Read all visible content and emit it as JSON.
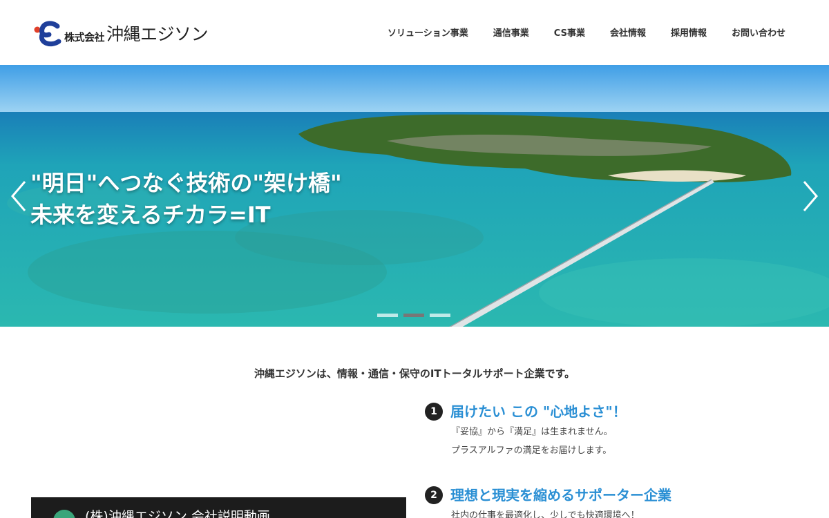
{
  "header": {
    "logo_small": "株式会社",
    "logo_big": "沖縄エジソン",
    "nav": [
      {
        "label": "ソリューション事業"
      },
      {
        "label": "通信事業"
      },
      {
        "label": "CS事業"
      },
      {
        "label": "会社情報"
      },
      {
        "label": "採用情報"
      },
      {
        "label": "お問い合わせ"
      }
    ]
  },
  "hero": {
    "line1": "\"明日\"へつなぐ技術の\"架け橋\"",
    "line2": "未来を変えるチカラ=IT",
    "slide_count": 3,
    "active_slide": 2
  },
  "intro": "沖縄エジソンは、情報・通信・保守のITトータルサポート企業です。",
  "video": {
    "title": "(株)沖縄エジソン 会社説明動画"
  },
  "features": [
    {
      "number": "1",
      "title": "届けたい この \"心地よさ\"！",
      "lines": [
        "『妥協』から『満足』は生まれません。",
        "プラスアルファの満足をお届けします。"
      ]
    },
    {
      "number": "2",
      "title": "理想と現実を縮めるサポーター企業",
      "lines": [
        "社内の仕事を最適化し、少しでも快適環境へ！"
      ]
    }
  ],
  "colors": {
    "accent": "#2a8fd4",
    "logo_blue": "#1f3f9a",
    "logo_red": "#e0402a"
  }
}
